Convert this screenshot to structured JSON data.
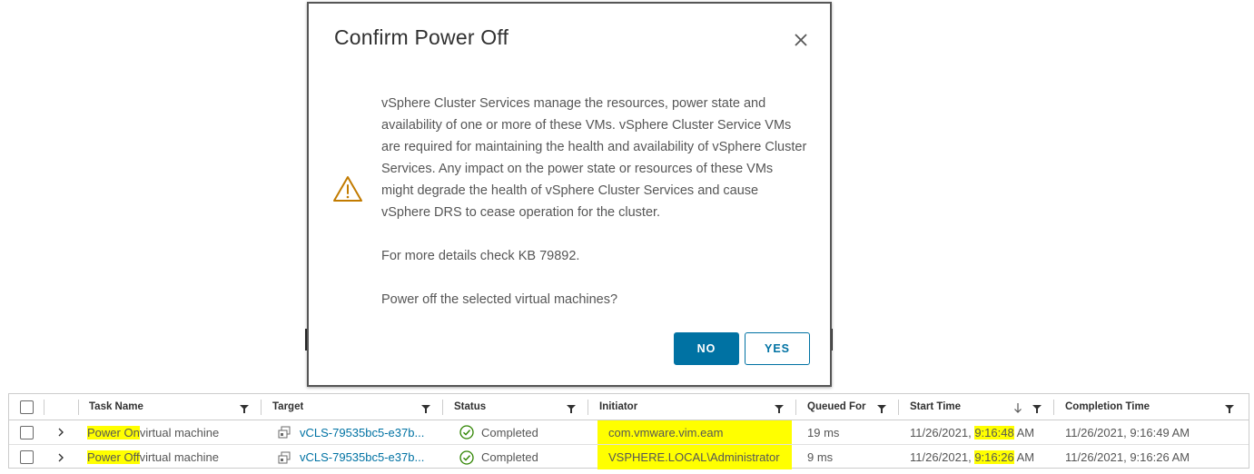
{
  "dialog": {
    "title": "Confirm Power Off",
    "message": "vSphere Cluster Services manage the resources, power state and availability of one or more of these VMs. vSphere Cluster Service VMs are required for maintaining the health and availability of vSphere Cluster Services. Any impact on the power state or resources of these VMs might degrade the health of vSphere Cluster Services and cause vSphere DRS to cease operation for the cluster.",
    "kb_text": "For more details check KB 79892.",
    "question": "Power off the selected virtual machines?",
    "no_label": "NO",
    "yes_label": "YES",
    "warning_icon": "warning-triangle-icon",
    "accent_color": "#0072a3",
    "warning_color": "#c27b00"
  },
  "task_grid": {
    "columns": [
      "Task Name",
      "Target",
      "Status",
      "Initiator",
      "Queued For",
      "Start Time",
      "Completion Time"
    ],
    "rows": [
      {
        "task_highlight": "Power On",
        "task_rest": " virtual machine",
        "target": "vCLS-79535bc5-e37b...",
        "status": "Completed",
        "initiator": "com.vmware.vim.eam",
        "queued_for": "19 ms",
        "start_prefix": "11/26/2021, ",
        "start_highlight": "9:16:48",
        "start_suffix": " AM",
        "completion_time": "11/26/2021, 9:16:49 AM"
      },
      {
        "task_highlight": "Power Off",
        "task_rest": " virtual machine",
        "target": "vCLS-79535bc5-e37b...",
        "status": "Completed",
        "initiator": "VSPHERE.LOCAL\\Administrator",
        "queued_for": "9 ms",
        "start_prefix": "11/26/2021, ",
        "start_highlight": "9:16:26",
        "start_suffix": " AM",
        "completion_time": "11/26/2021, 9:16:26 AM"
      }
    ],
    "highlight_color": "#ffff00",
    "sort_column": "Start Time",
    "sort_direction": "descending"
  }
}
